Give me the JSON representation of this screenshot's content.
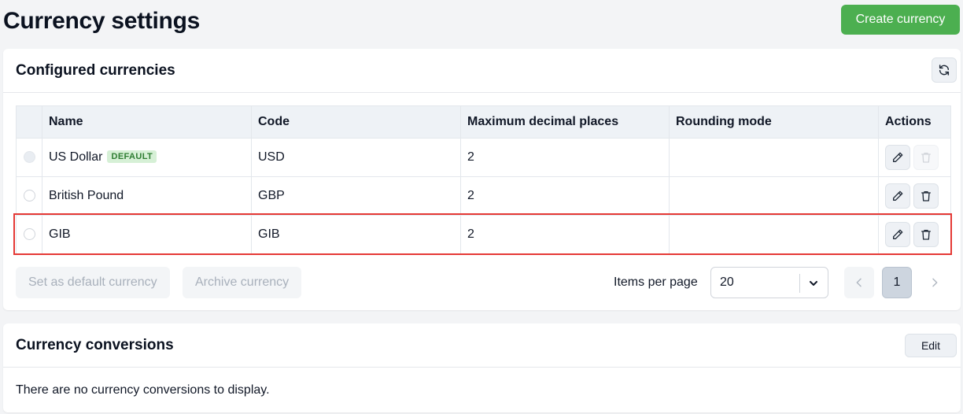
{
  "page": {
    "title": "Currency settings",
    "create_button": "Create currency"
  },
  "configured": {
    "title": "Configured currencies",
    "columns": [
      "Name",
      "Code",
      "Maximum decimal places",
      "Rounding mode",
      "Actions"
    ],
    "rows": [
      {
        "name": "US Dollar",
        "badge": "DEFAULT",
        "code": "USD",
        "decimals": "2",
        "rounding": ""
      },
      {
        "name": "British Pound",
        "badge": "",
        "code": "GBP",
        "decimals": "2",
        "rounding": ""
      },
      {
        "name": "GIB",
        "badge": "",
        "code": "GIB",
        "decimals": "2",
        "rounding": ""
      }
    ],
    "set_default_button": "Set as default currency",
    "archive_button": "Archive currency",
    "items_per_page_label": "Items per page",
    "items_per_page_value": "20",
    "current_page": "1"
  },
  "conversions": {
    "title": "Currency conversions",
    "edit_button": "Edit",
    "empty_message": "There are no currency conversions to display."
  },
  "colors": {
    "accent_green": "#4caf50",
    "highlight_red": "#e53935"
  },
  "icons": {
    "refresh": "refresh-icon",
    "edit": "pencil-icon",
    "delete": "trash-icon",
    "select_arrow": "chevron-down-icon",
    "prev": "chevron-left-icon",
    "next": "chevron-right-icon"
  }
}
